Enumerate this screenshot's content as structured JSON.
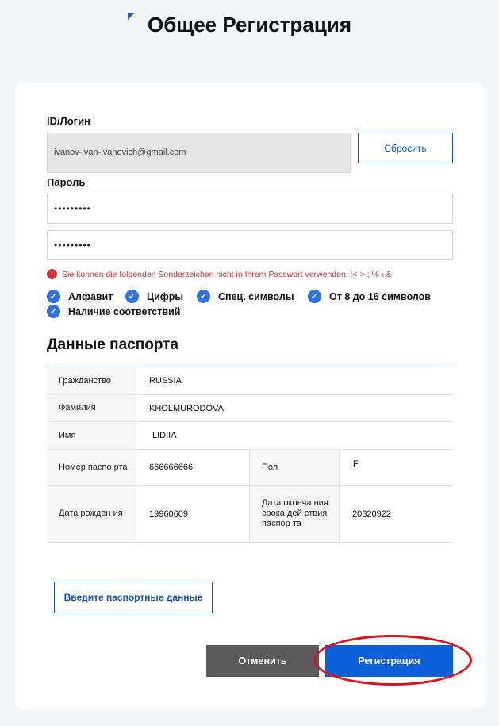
{
  "header": {
    "title": "Общее Регистрация"
  },
  "form": {
    "login_label": "ID/Логин",
    "login_value": "ivanov-ivan-ivanovich@gmail.com",
    "reset_label": "Сбросить",
    "password_label": "Пароль",
    "password_mask": "•••••••••",
    "password_confirm_mask": "•••••••••",
    "error_text": "Sie konnen die folgenden Sonderzeichen nicht in Ihrem Passwort verwenden. [< > ; % \\ &]",
    "checks": [
      "Алфавит",
      "Цифры",
      "Спец. символы",
      "От 8 до 16 символов",
      "Наличие соответствий"
    ]
  },
  "passport": {
    "title": "Данные паспорта",
    "rows": [
      {
        "label": "Гражданство",
        "value": "RUSSIA"
      },
      {
        "label": "Фамилия",
        "value": "KHOLMURODOVA"
      },
      {
        "label": "Имя",
        "value": "LIDIIA"
      }
    ],
    "number_label": "Номер паспо рта",
    "number_value": "666666666",
    "sex_label": "Пол",
    "sex_value": "F",
    "birth_label": "Дата рожден ия",
    "birth_value": "19960609",
    "expiry_label": "Дата оконча ния срока дей ствия паспор та",
    "expiry_value": "20320922"
  },
  "actions": {
    "passport_button": "Введите паспортные данные",
    "cancel": "Отменить",
    "register": "Регистрация"
  },
  "colors": {
    "primary": "#0b5fd8",
    "error": "#c0383c",
    "highlight": "#d8131e"
  }
}
